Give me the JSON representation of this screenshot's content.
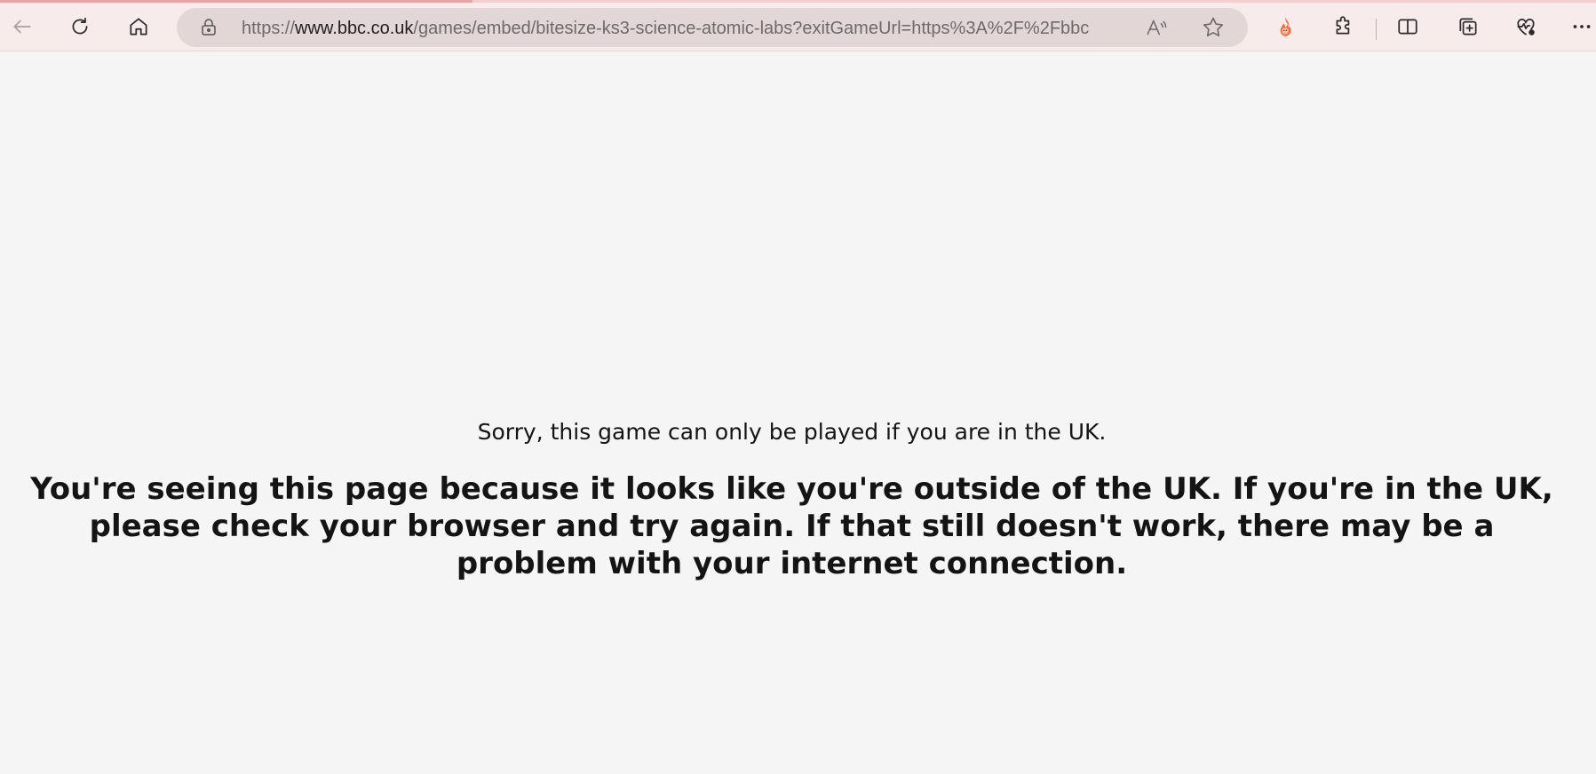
{
  "browser": {
    "url_prefix": "https://",
    "url_host": "www.bbc.co.uk",
    "url_path": "/games/embed/bitesize-ks3-science-atomic-labs?exitGameUrl=https%3A%2F%2Fbbc",
    "icons": {
      "back": "back-arrow-icon",
      "refresh": "refresh-icon",
      "home": "home-icon",
      "lock": "lock-icon",
      "read_aloud": "read-aloud-icon",
      "favorite": "star-icon",
      "profile_flame": "flame-extension-icon",
      "extensions": "puzzle-icon",
      "split_screen": "split-screen-icon",
      "collections": "collections-icon",
      "browser_essentials": "heart-pulse-icon",
      "menu": "more-dots-icon"
    },
    "colors": {
      "toolbar_bg": "#f7ebeb",
      "address_bg": "#e3d6d6",
      "page_bg": "#f5f5f5",
      "flame": "#f26b3a"
    }
  },
  "page": {
    "sorry_message": "Sorry, this game can only be played if you are in the UK.",
    "explanation": "You're seeing this page because it looks like you're outside of the UK. If you're in the UK, please check your browser and try again. If that still doesn't work, there may be a problem with your internet connection."
  }
}
